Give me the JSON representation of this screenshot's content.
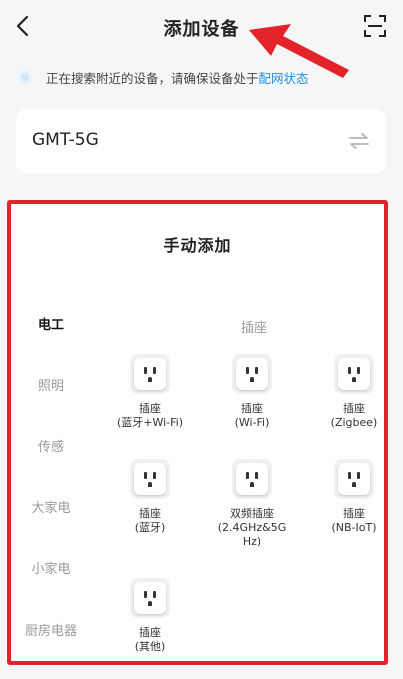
{
  "header": {
    "title": "添加设备",
    "back_icon": "chevron-left-icon",
    "scan_icon": "scan-icon"
  },
  "hint": {
    "text": "正在搜索附近的设备，请确保设备处于",
    "link": "配网状态"
  },
  "wifi": {
    "ssid": "GMT-5G",
    "switch_icon": "swap-icon"
  },
  "manual": {
    "heading": "手动添加",
    "categories": [
      {
        "label": "电工",
        "active": true
      },
      {
        "label": "照明",
        "active": false
      },
      {
        "label": "传感",
        "active": false
      },
      {
        "label": "大家电",
        "active": false
      },
      {
        "label": "小家电",
        "active": false
      },
      {
        "label": "厨房电器",
        "active": false
      }
    ],
    "section_title": "插座",
    "devices": [
      {
        "line1": "插座",
        "line2": "(蓝牙+Wi-Fi)",
        "line3": ""
      },
      {
        "line1": "插座",
        "line2": "(Wi-Fi)",
        "line3": ""
      },
      {
        "line1": "插座",
        "line2": "(Zigbee)",
        "line3": ""
      },
      {
        "line1": "插座",
        "line2": "(蓝牙)",
        "line3": ""
      },
      {
        "line1": "双频插座",
        "line2": "(2.4GHz&5G",
        "line3": "Hz)"
      },
      {
        "line1": "插座",
        "line2": "(NB-IoT)",
        "line3": ""
      },
      {
        "line1": "插座",
        "line2": "(其他)",
        "line3": ""
      }
    ]
  },
  "colors": {
    "highlight": "#e2232a",
    "link": "#1f8fe5",
    "background": "#f5f6f7"
  }
}
